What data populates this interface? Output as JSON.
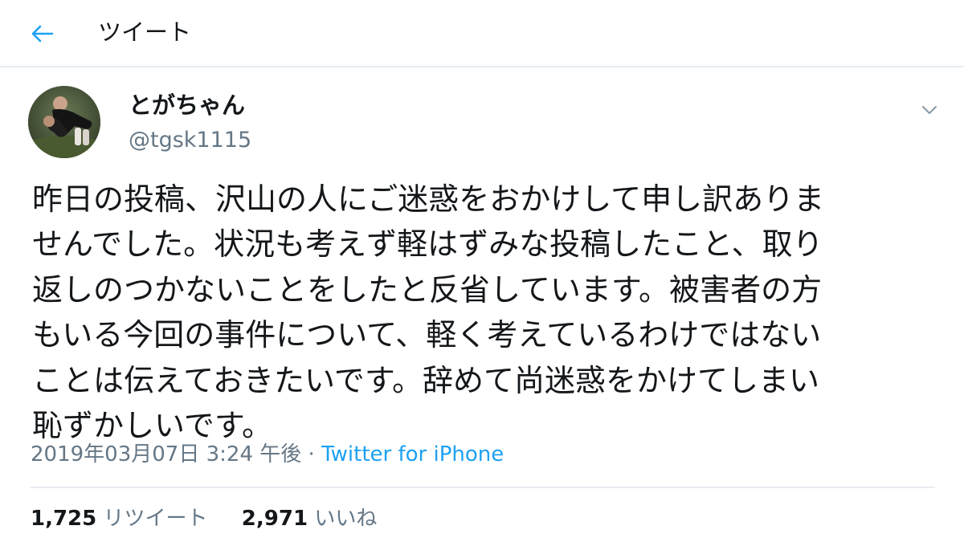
{
  "header": {
    "back_icon": "arrow-left-icon",
    "title": "ツイート",
    "accent_color": "#1da1f2"
  },
  "author": {
    "display_name": "とがちゃん",
    "handle": "@tgsk1115",
    "avatar": "avatar-photo"
  },
  "menu_icon": "chevron-down-icon",
  "tweet": {
    "text": "昨日の投稿、沢山の人にご迷惑をおかけして申し訳ありま\nせんでした。状況も考えず軽はずみな投稿したこと、取り\n返しのつかないことをしたと反省しています。被害者の方\nもいる今回の事件について、軽く考えているわけではない\nことは伝えておきたいです。辞めて尚迷惑をかけてしまい\n恥ずかしいです。",
    "timestamp": "2019年03月07日 3:24 午後",
    "separator": "·",
    "source": "Twitter for iPhone"
  },
  "stats": {
    "retweets_count": "1,725",
    "retweets_label": "リツイート",
    "likes_count": "2,971",
    "likes_label": "いいね"
  }
}
